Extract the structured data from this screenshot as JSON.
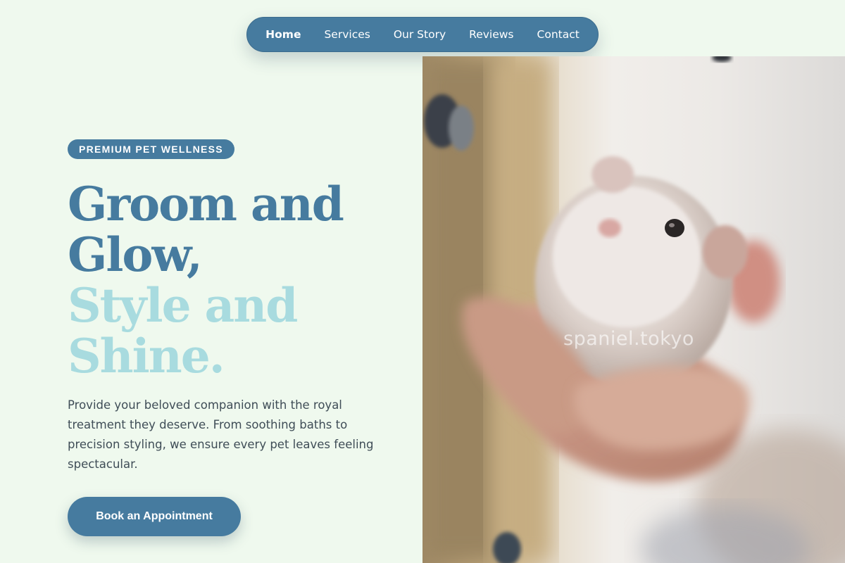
{
  "nav": {
    "items": [
      {
        "label": "Home",
        "active": true
      },
      {
        "label": "Services",
        "active": false
      },
      {
        "label": "Our Story",
        "active": false
      },
      {
        "label": "Reviews",
        "active": false
      },
      {
        "label": "Contact",
        "active": false
      }
    ]
  },
  "hero": {
    "badge": "PREMIUM PET WELLNESS",
    "headline_dark": [
      "Groom and",
      "Glow,"
    ],
    "headline_light": [
      "Style and",
      "Shine."
    ],
    "description": "Provide your beloved companion with the royal treatment they deserve. From soothing baths to precision styling, we ensure every pet leaves feeling spectacular.",
    "cta": "Book an Appointment"
  },
  "photo": {
    "watermark": "spaniel.tokyo"
  },
  "colors": {
    "background": "#eff9ee",
    "primary": "#467b9f",
    "accent_light": "#a8dbdf",
    "body_text": "#3f4d57"
  }
}
